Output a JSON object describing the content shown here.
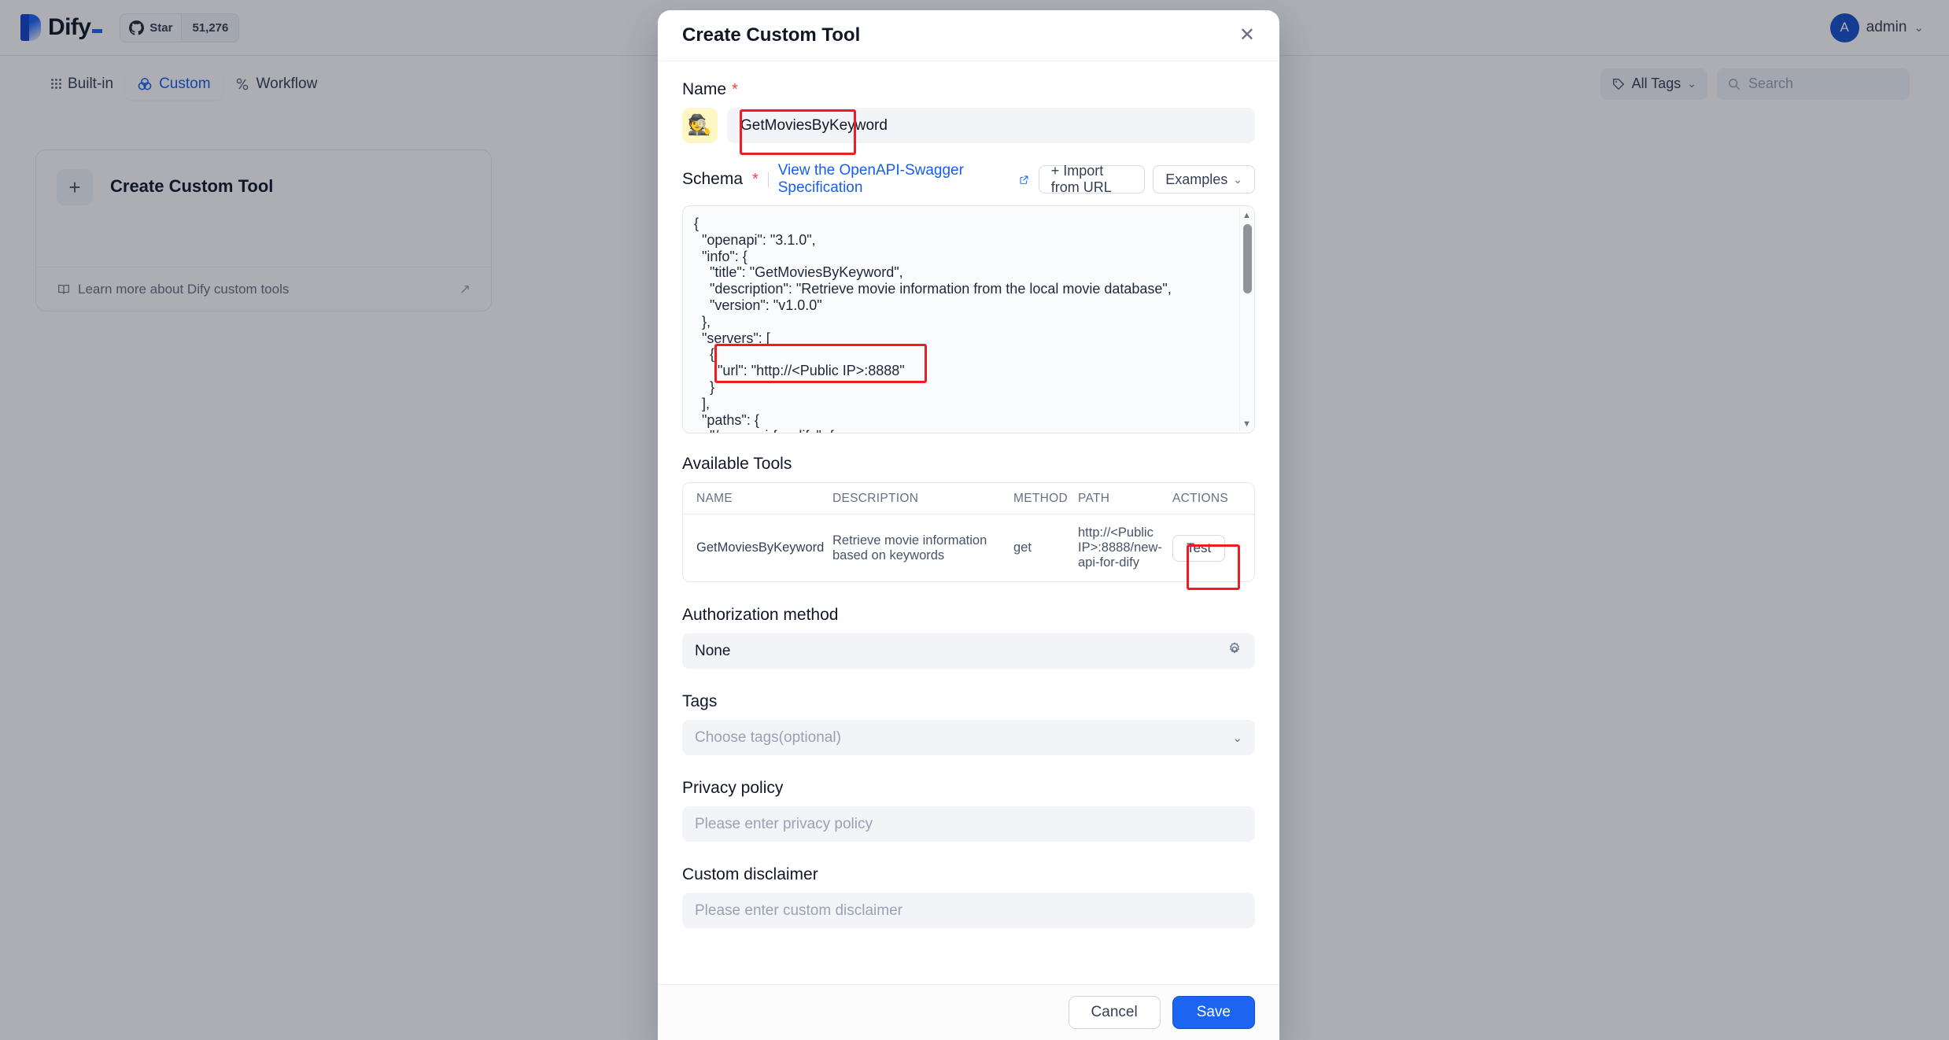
{
  "app": {
    "logo_text": "Dify",
    "star_label": "Star",
    "star_count": "51,276",
    "user_name": "admin",
    "avatar_initial": "A"
  },
  "tabs": [
    {
      "label": "Built-in",
      "icon": "grid-icon",
      "active": false
    },
    {
      "label": "Custom",
      "icon": "venn-icon",
      "active": true
    },
    {
      "label": "Workflow",
      "icon": "workflow-icon",
      "active": false
    }
  ],
  "filters": {
    "all_tags_label": "All Tags",
    "search_placeholder": "Search"
  },
  "tool_card": {
    "plus": "+",
    "title": "Create Custom Tool",
    "footer_link": "Learn more about Dify custom tools",
    "footer_arrow": "↗"
  },
  "modal": {
    "title": "Create Custom Tool",
    "close_icon": "✕",
    "name": {
      "label": "Name",
      "required_mark": "*",
      "emoji": "🕵️",
      "value": "GetMoviesByKeyword"
    },
    "schema": {
      "label": "Schema",
      "required_mark": "*",
      "spec_link": "View the OpenAPI-Swagger Specification",
      "spec_link_icon": "↗",
      "import_button": "+ Import from URL",
      "examples_button": "Examples",
      "examples_chevron": "⌄",
      "code": "{\n  \"openapi\": \"3.1.0\",\n  \"info\": {\n    \"title\": \"GetMoviesByKeyword\",\n    \"description\": \"Retrieve movie information from the local movie database\",\n    \"version\": \"v1.0.0\"\n  },\n  \"servers\": [\n    {\n      \"url\": \"http://<Public IP>:8888\"\n    }\n  ],\n  \"paths\": {\n    \"/new-api-for-dify\": {\n      \"get\": {"
    },
    "available_tools": {
      "title": "Available Tools",
      "columns": [
        "NAME",
        "DESCRIPTION",
        "METHOD",
        "PATH",
        "ACTIONS"
      ],
      "rows": [
        {
          "name": "GetMoviesByKeyword",
          "description": "Retrieve movie information based on keywords",
          "method": "get",
          "path": "http://<Public IP>:8888/new-api-for-dify",
          "action": "Test"
        }
      ]
    },
    "authorization": {
      "label": "Authorization method",
      "value": "None",
      "gear_icon": "⚙"
    },
    "tags": {
      "label": "Tags",
      "placeholder": "Choose tags(optional)",
      "chevron": "⌄"
    },
    "privacy": {
      "label": "Privacy policy",
      "placeholder": "Please enter privacy policy"
    },
    "disclaimer": {
      "label": "Custom disclaimer",
      "placeholder": "Please enter custom disclaimer"
    },
    "footer": {
      "cancel": "Cancel",
      "save": "Save"
    }
  },
  "colors": {
    "accent": "#1c64f2",
    "link": "#155eef",
    "required": "#f04438",
    "annotation": "#ee1c25",
    "avatar_bg": "#1650c8",
    "emoji_bg": "#fef7c3"
  }
}
